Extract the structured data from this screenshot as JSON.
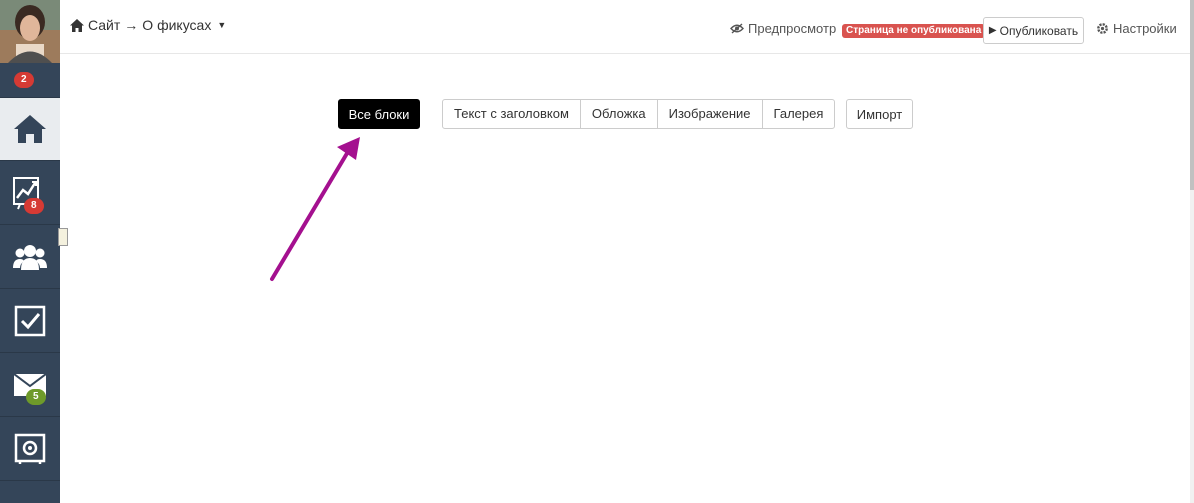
{
  "sidebar": {
    "avatar_badge": "2",
    "items": [
      {
        "icon": "home-icon",
        "active": true
      },
      {
        "icon": "chart-icon",
        "badge": "8",
        "badge_color": "#d63a34"
      },
      {
        "icon": "users-icon"
      },
      {
        "icon": "checkbox-icon"
      },
      {
        "icon": "mail-icon",
        "badge": "5",
        "badge_color": "#6e9a2a"
      },
      {
        "icon": "settings-box-icon"
      }
    ]
  },
  "header": {
    "breadcrumb": {
      "site": "Сайт",
      "separator": "→",
      "page": "О фикусах"
    },
    "preview_label": "Предпросмотр",
    "status_label": "Страница не опубликована",
    "publish_label": "Опубликовать",
    "settings_label": "Настройки"
  },
  "filters": {
    "all_blocks": "Все блоки",
    "groups": [
      "Текст с заголовком",
      "Обложка",
      "Изображение",
      "Галерея"
    ],
    "import": "Импорт"
  },
  "colors": {
    "sidebar_bg": "#344559",
    "active_bg": "#e9ecef",
    "status_red": "#d9534f",
    "arrow": "#a4108f"
  }
}
